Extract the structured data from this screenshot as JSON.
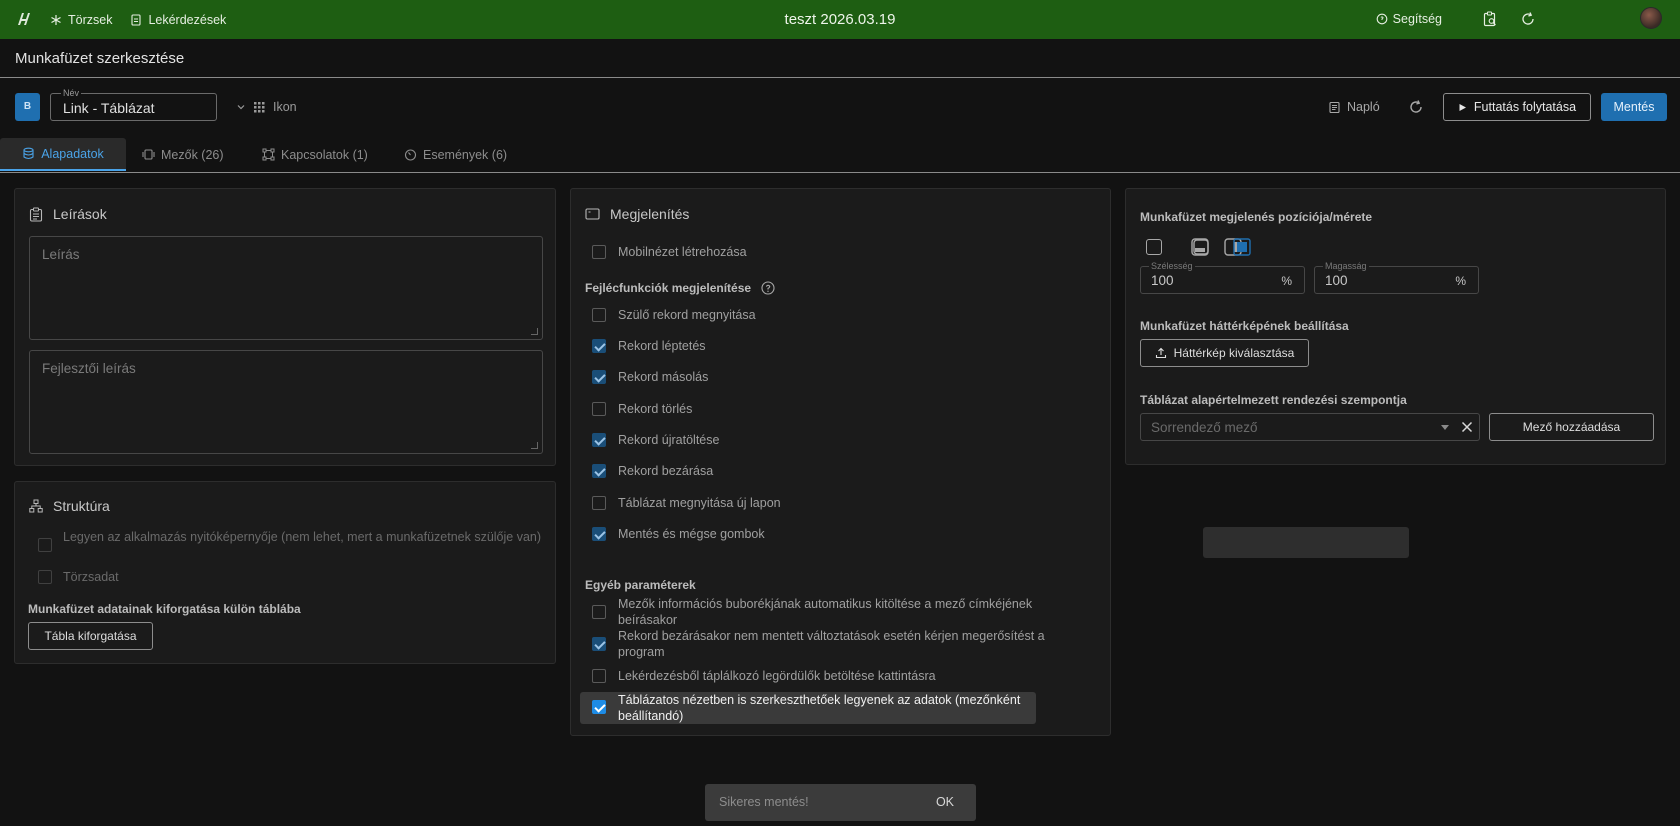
{
  "topbar": {
    "nav": [
      "Törzsek",
      "Lekérdezések"
    ],
    "app_title": "teszt 2026.03.19",
    "help_label": "Segítség",
    "bg_color": "#1e5e12"
  },
  "page": {
    "title": "Munkafüzet szerkesztése"
  },
  "toolbar": {
    "badge": "B",
    "name_label": "Név",
    "name_value": "Link - Táblázat",
    "icon_label": "Ikon",
    "log_label": "Napló",
    "continue_label": "Futtatás folytatása",
    "save_label": "Mentés",
    "accent_color": "#1f6fb0"
  },
  "tabs": [
    {
      "label": "Alapadatok",
      "active": true
    },
    {
      "label": "Mezők (26)",
      "active": false
    },
    {
      "label": "Kapcsolatok (1)",
      "active": false
    },
    {
      "label": "Események (6)",
      "active": false
    }
  ],
  "descriptions": {
    "title": "Leírások",
    "description_placeholder": "Leírás",
    "dev_description_placeholder": "Fejlesztői leírás"
  },
  "structure": {
    "title": "Struktúra",
    "checkbox_startscreen": "Legyen az alkalmazás nyitóképernyője (nem lehet, mert a munkafüzetnek szülője van)",
    "checkbox_master": "Törzsadat",
    "rotate_section": "Munkafüzet adatainak kiforgatása külön táblába",
    "rotate_button": "Tábla kiforgatása"
  },
  "display": {
    "title": "Megjelenítés",
    "mobile_view": {
      "label": "Mobilnézet létrehozása",
      "checked": false
    },
    "header_section": "Fejlécfunkciók megjelenítése",
    "header_items": [
      {
        "label": "Szülő rekord megnyitása",
        "checked": false
      },
      {
        "label": "Rekord léptetés",
        "checked": true
      },
      {
        "label": "Rekord másolás",
        "checked": true
      },
      {
        "label": "Rekord törlés",
        "checked": false
      },
      {
        "label": "Rekord újratöltése",
        "checked": true
      },
      {
        "label": "Rekord bezárása",
        "checked": true
      },
      {
        "label": "Táblázat megnyitása új lapon",
        "checked": false
      },
      {
        "label": "Mentés és mégse gombok",
        "checked": true
      }
    ],
    "other_section": "Egyéb paraméterek",
    "other_items": [
      {
        "label": "Mezők információs buborékjának automatikus kitöltése a mező címkéjének beírásakor",
        "checked": false
      },
      {
        "label": "Rekord bezárásakor nem mentett változtatások esetén kérjen megerősítést a program",
        "checked": true
      },
      {
        "label": "Lekérdezésből táplálkozó legördülők betöltése kattintásra",
        "checked": false
      },
      {
        "label": "Táblázatos nézetben is szerkeszthetőek legyenek az adatok (mezőnként beállítandó)",
        "checked": true
      }
    ]
  },
  "position": {
    "title": "Munkafüzet megjelenés pozíciója/mérete",
    "width_label": "Szélesség",
    "width_value": "100",
    "height_label": "Magasság",
    "height_value": "100",
    "unit": "%",
    "bg_title": "Munkafüzet háttérképének beállítása",
    "bg_button": "Háttérkép kiválasztása",
    "sort_title": "Táblázat alapértelmezett rendezési szempontja",
    "sort_placeholder": "Sorrendező mező",
    "add_field_button": "Mező hozzáadása"
  },
  "toast": {
    "message": "Sikeres mentés!",
    "ok": "OK"
  }
}
